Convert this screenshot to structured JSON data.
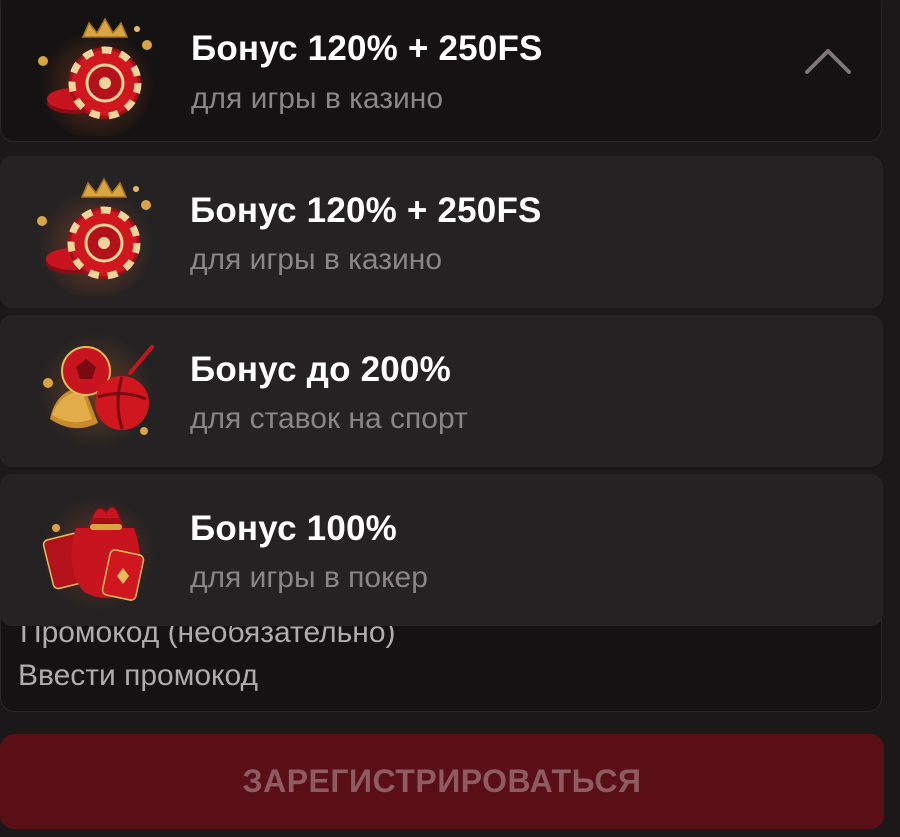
{
  "bonus_select": {
    "selected": {
      "title": "Бонус 120% + 250FS",
      "subtitle": "для игры в казино",
      "icon": "casino-chip-crown-icon"
    },
    "expanded": true,
    "toggle_icon": "chevron-up-icon",
    "options": [
      {
        "title": "Бонус 120% + 250FS",
        "subtitle": "для игры в казино",
        "icon": "casino-chip-crown-icon"
      },
      {
        "title": "Бонус до 200%",
        "subtitle": "для ставок на спорт",
        "icon": "sports-balls-icon"
      },
      {
        "title": "Бонус 100%",
        "subtitle": "для игры в покер",
        "icon": "poker-bag-icon"
      }
    ]
  },
  "promo": {
    "label": "Промокод (необязательно)",
    "placeholder": "Ввести промокод",
    "value": ""
  },
  "register_button": {
    "label": "ЗАРЕГИСТРИРОВАТЬСЯ"
  },
  "colors": {
    "background": "#1a1819",
    "field_background": "#141213",
    "option_background": "#242223",
    "title_text": "#ffffff",
    "subtitle_text": "#8b8587",
    "register_button": "#5a0f17",
    "register_button_text": "#8e5b60",
    "accent_red": "#c8141e",
    "accent_gold": "#d9a441"
  }
}
